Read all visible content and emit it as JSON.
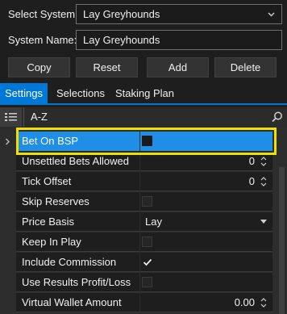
{
  "form": {
    "select_system_label": "Select System:",
    "select_system_value": "Lay Greyhounds",
    "system_name_label": "System Name:",
    "system_name_value": "Lay Greyhounds"
  },
  "buttons": {
    "copy": "Copy",
    "reset": "Reset",
    "add": "Add",
    "delete": "Delete"
  },
  "tabs": {
    "settings": "Settings",
    "selections": "Selections",
    "staking_plan": "Staking Plan"
  },
  "toolbar": {
    "sort_az": "A-Z"
  },
  "grid": {
    "rows": [
      {
        "name": "Bet On BSP",
        "type": "checkbox",
        "checked": false
      },
      {
        "name": "Unsettled Bets Allowed",
        "type": "number",
        "value": "0"
      },
      {
        "name": "Tick Offset",
        "type": "number",
        "value": "0"
      },
      {
        "name": "Skip Reserves",
        "type": "checkbox",
        "checked": false
      },
      {
        "name": "Price Basis",
        "type": "select",
        "value": "Lay"
      },
      {
        "name": "Keep In Play",
        "type": "checkbox",
        "checked": false
      },
      {
        "name": "Include Commission",
        "type": "checkbox",
        "checked": true
      },
      {
        "name": "Use Results Profit/Loss",
        "type": "checkbox",
        "checked": false
      },
      {
        "name": "Virtual Wallet Amount",
        "type": "number",
        "value": "0.00"
      }
    ]
  },
  "colors": {
    "accent": "#0078d7",
    "selected_row": "#1e8ee6",
    "highlight_box": "#f0e000"
  }
}
